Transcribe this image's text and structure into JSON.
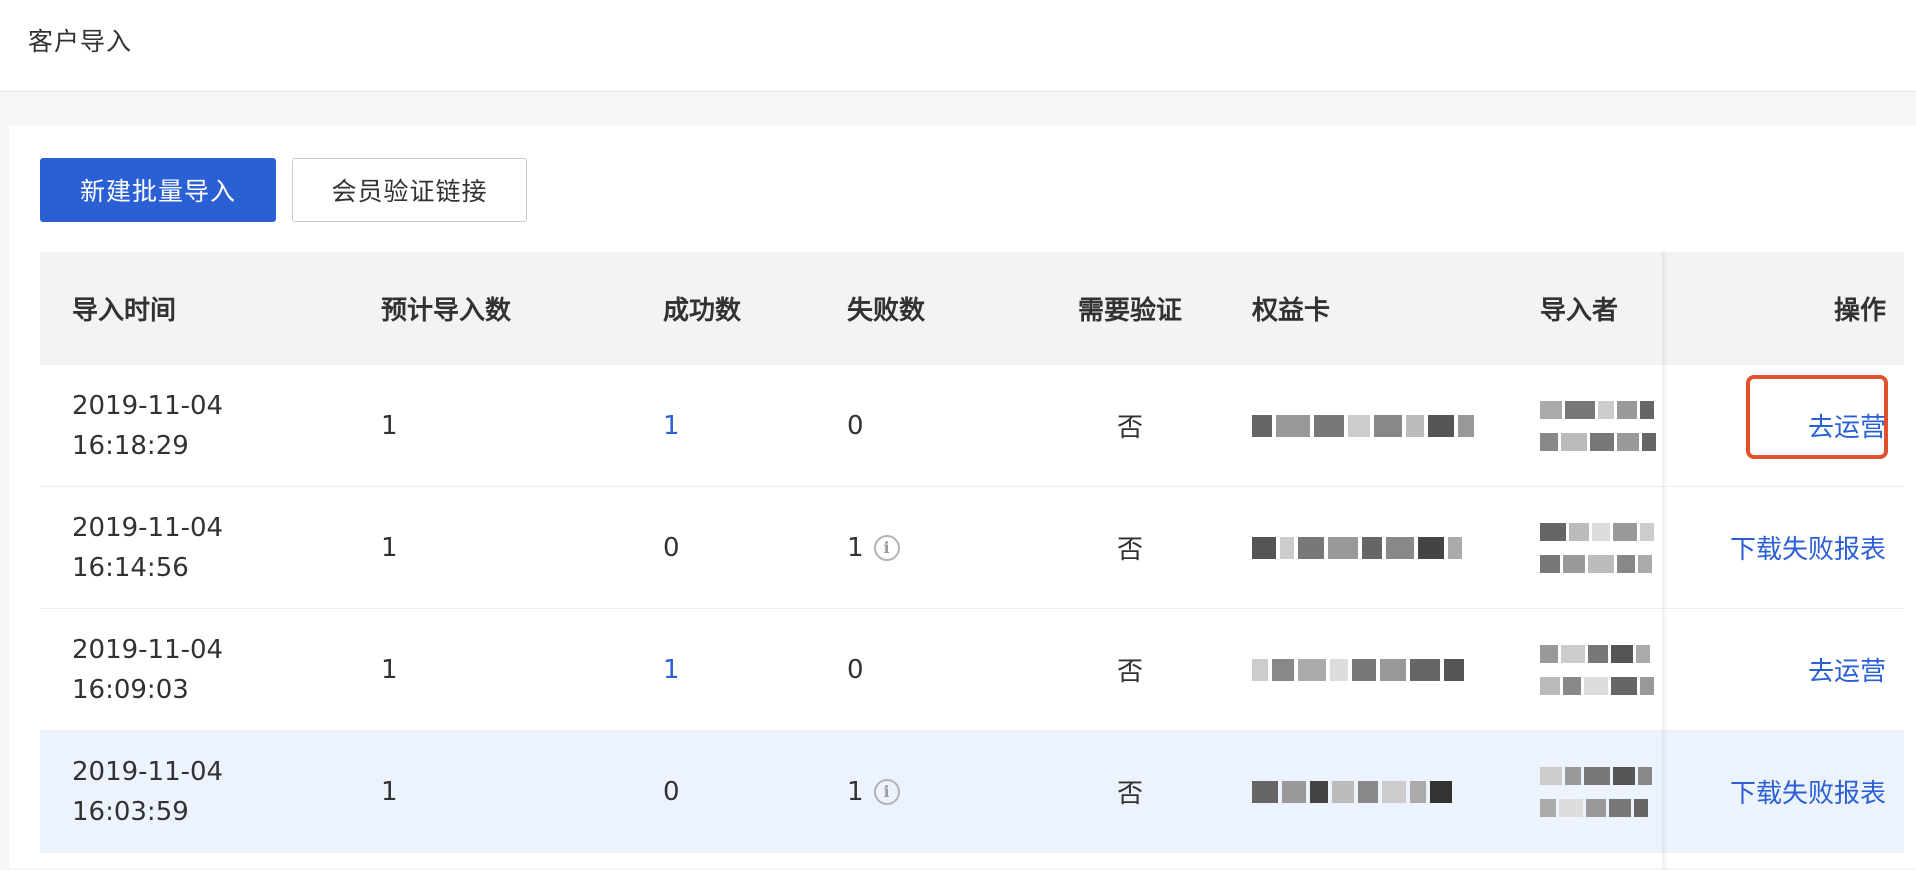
{
  "page": {
    "title": "客户导入"
  },
  "toolbar": {
    "new_import": "新建批量导入",
    "verify_link": "会员验证链接"
  },
  "table": {
    "headers": {
      "time": "导入时间",
      "expected": "预计导入数",
      "success": "成功数",
      "fail": "失败数",
      "verify": "需要验证",
      "card": "权益卡",
      "importer": "导入者",
      "action": "操作"
    },
    "rows": [
      {
        "date": "2019-11-04",
        "time": "16:18:29",
        "expected": "1",
        "success": "1",
        "fail": "0",
        "verify": "否",
        "action": "去运营"
      },
      {
        "date": "2019-11-04",
        "time": "16:14:56",
        "expected": "1",
        "success": "0",
        "fail": "1",
        "verify": "否",
        "action": "下载失败报表"
      },
      {
        "date": "2019-11-04",
        "time": "16:09:03",
        "expected": "1",
        "success": "1",
        "fail": "0",
        "verify": "否",
        "action": "去运营"
      },
      {
        "date": "2019-11-04",
        "time": "16:03:59",
        "expected": "1",
        "success": "0",
        "fail": "1",
        "verify": "否",
        "action": "下载失败报表"
      }
    ]
  },
  "colors": {
    "accent": "#2b5fd4",
    "highlight": "#e0512e",
    "hover_row": "#edf3fd"
  }
}
